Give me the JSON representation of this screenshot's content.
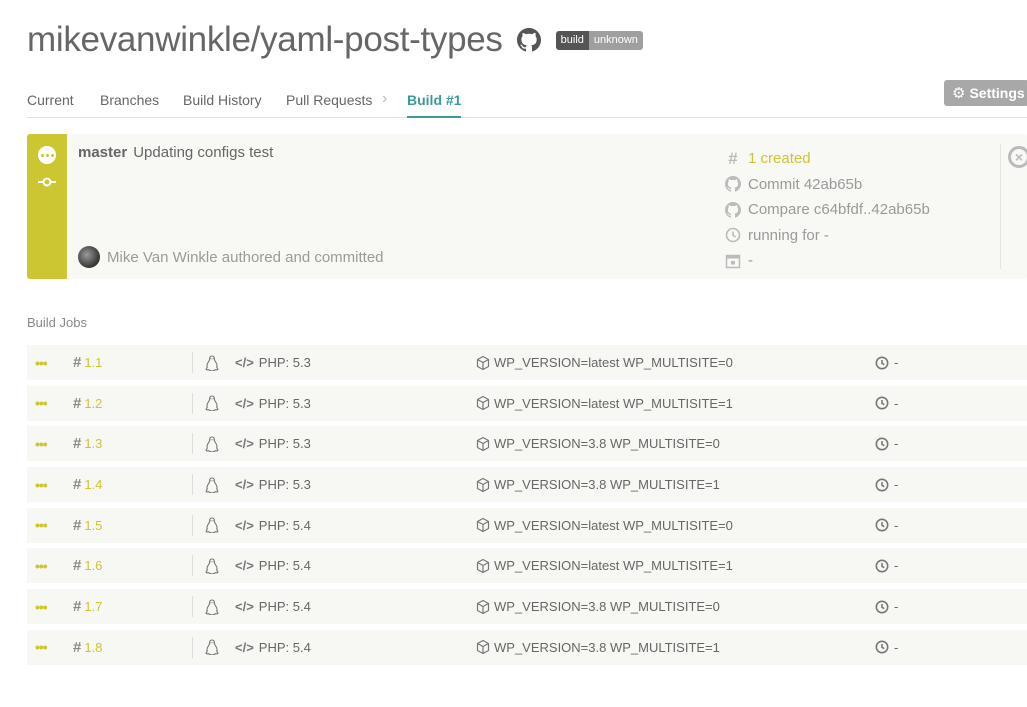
{
  "header": {
    "repo": "mikevanwinkle/yaml-post-types",
    "badge_left": "build",
    "badge_right": "unknown"
  },
  "tabs": [
    {
      "label": "Current"
    },
    {
      "label": "Branches"
    },
    {
      "label": "Build History"
    },
    {
      "label": "Pull Requests"
    },
    {
      "label": "Build #1"
    }
  ],
  "settings": {
    "label": "Settings"
  },
  "build": {
    "branch": "master",
    "message": "Updating configs test",
    "author": "Mike Van Winkle authored and committed",
    "status": "created",
    "created": "1 created",
    "commit": "Commit 42ab65b",
    "compare": "Compare c64bfdf..42ab65b",
    "running": "running for -",
    "date": "-"
  },
  "jobs_heading": "Build Jobs",
  "jobs": [
    {
      "number": "1.1",
      "lang": "PHP: 5.3",
      "env": "WP_VERSION=latest WP_MULTISITE=0",
      "duration": "-"
    },
    {
      "number": "1.2",
      "lang": "PHP: 5.3",
      "env": "WP_VERSION=latest WP_MULTISITE=1",
      "duration": "-"
    },
    {
      "number": "1.3",
      "lang": "PHP: 5.3",
      "env": "WP_VERSION=3.8 WP_MULTISITE=0",
      "duration": "-"
    },
    {
      "number": "1.4",
      "lang": "PHP: 5.3",
      "env": "WP_VERSION=3.8 WP_MULTISITE=1",
      "duration": "-"
    },
    {
      "number": "1.5",
      "lang": "PHP: 5.4",
      "env": "WP_VERSION=latest WP_MULTISITE=0",
      "duration": "-"
    },
    {
      "number": "1.6",
      "lang": "PHP: 5.4",
      "env": "WP_VERSION=latest WP_MULTISITE=1",
      "duration": "-"
    },
    {
      "number": "1.7",
      "lang": "PHP: 5.4",
      "env": "WP_VERSION=3.8 WP_MULTISITE=0",
      "duration": "-"
    },
    {
      "number": "1.8",
      "lang": "PHP: 5.4",
      "env": "WP_VERSION=3.8 WP_MULTISITE=1",
      "duration": "-"
    }
  ],
  "colors": {
    "accent_teal": "#3a9a98",
    "status_yellow": "#cdc633",
    "row_bg": "#f7f7f4"
  }
}
